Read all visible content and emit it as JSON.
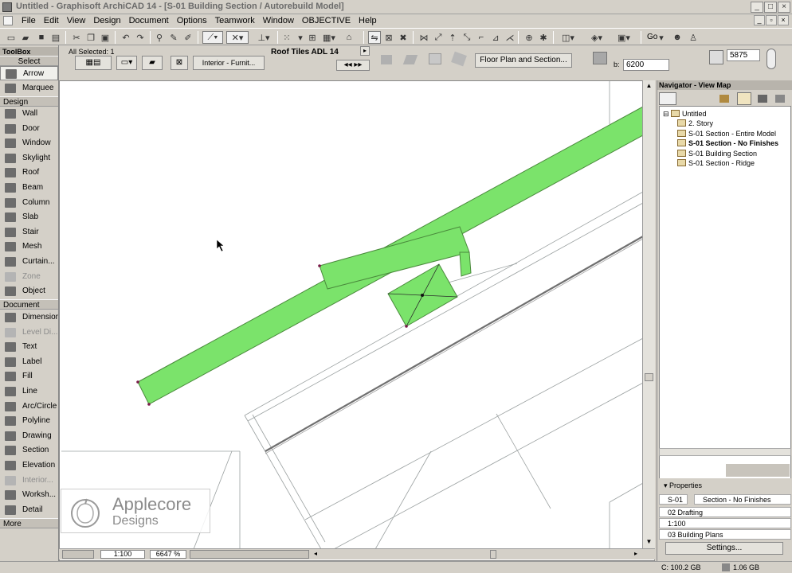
{
  "window": {
    "title": "Untitled - Graphisoft ArchiCAD 14 - [S-01 Building Section / Autorebuild Model]",
    "minimize": "_",
    "maximize": "□",
    "close": "×"
  },
  "menu": [
    "File",
    "Edit",
    "View",
    "Design",
    "Document",
    "Options",
    "Teamwork",
    "Window",
    "OBJECTIVE",
    "Help"
  ],
  "toolbar": {
    "go_label": "Go"
  },
  "toolbox": {
    "title": "ToolBox",
    "select_header": "Select",
    "select_items": [
      "Arrow",
      "Marquee"
    ],
    "design_header": "Design",
    "design_items": [
      "Wall",
      "Door",
      "Window",
      "Skylight",
      "Roof",
      "Beam",
      "Column",
      "Slab",
      "Stair",
      "Mesh",
      "Curtain...",
      "Zone",
      "Object"
    ],
    "document_header": "Document",
    "document_items": [
      "Dimension",
      "Level Di...",
      "Text",
      "Label",
      "Fill",
      "Line",
      "Arc/Circle",
      "Polyline",
      "Drawing",
      "Section",
      "Elevation",
      "Interior...",
      "Worksh...",
      "Detail"
    ],
    "more_label": "More"
  },
  "infobox": {
    "selected": "All Selected: 1",
    "layer_label": "Interior - Furnit...",
    "material": "Roof Tiles ADL 14",
    "floorplan_btn": "Floor Plan and Section...",
    "b_label": "b:",
    "b_value": "6200",
    "top_value": "5875"
  },
  "navigator": {
    "title": "Navigator - View Map",
    "tree": [
      {
        "label": "Untitled",
        "bold": false
      },
      {
        "label": "2. Story",
        "bold": false
      },
      {
        "label": "S-01 Section - Entire Model",
        "bold": false
      },
      {
        "label": "S-01 Section - No Finishes",
        "bold": true
      },
      {
        "label": "S-01 Building Section",
        "bold": false
      },
      {
        "label": "S-01 Section - Ridge",
        "bold": false
      }
    ],
    "properties_label": "Properties",
    "prop_id": "S-01",
    "prop_name": "Section - No Finishes",
    "prop_rows": [
      "02 Drafting",
      "1:100",
      "03 Building Plans"
    ],
    "settings_btn": "Settings..."
  },
  "canvas_status": {
    "scale": "1:100",
    "zoom": "6647 %"
  },
  "statusbar": {
    "disk_c": "C: 100.2 GB",
    "memory": "1.06 GB"
  },
  "watermark": {
    "line1": "Applecore",
    "line2": "Designs"
  },
  "colors": {
    "roof_fill": "#7be36b",
    "roof_stroke": "#4a8a3c"
  }
}
